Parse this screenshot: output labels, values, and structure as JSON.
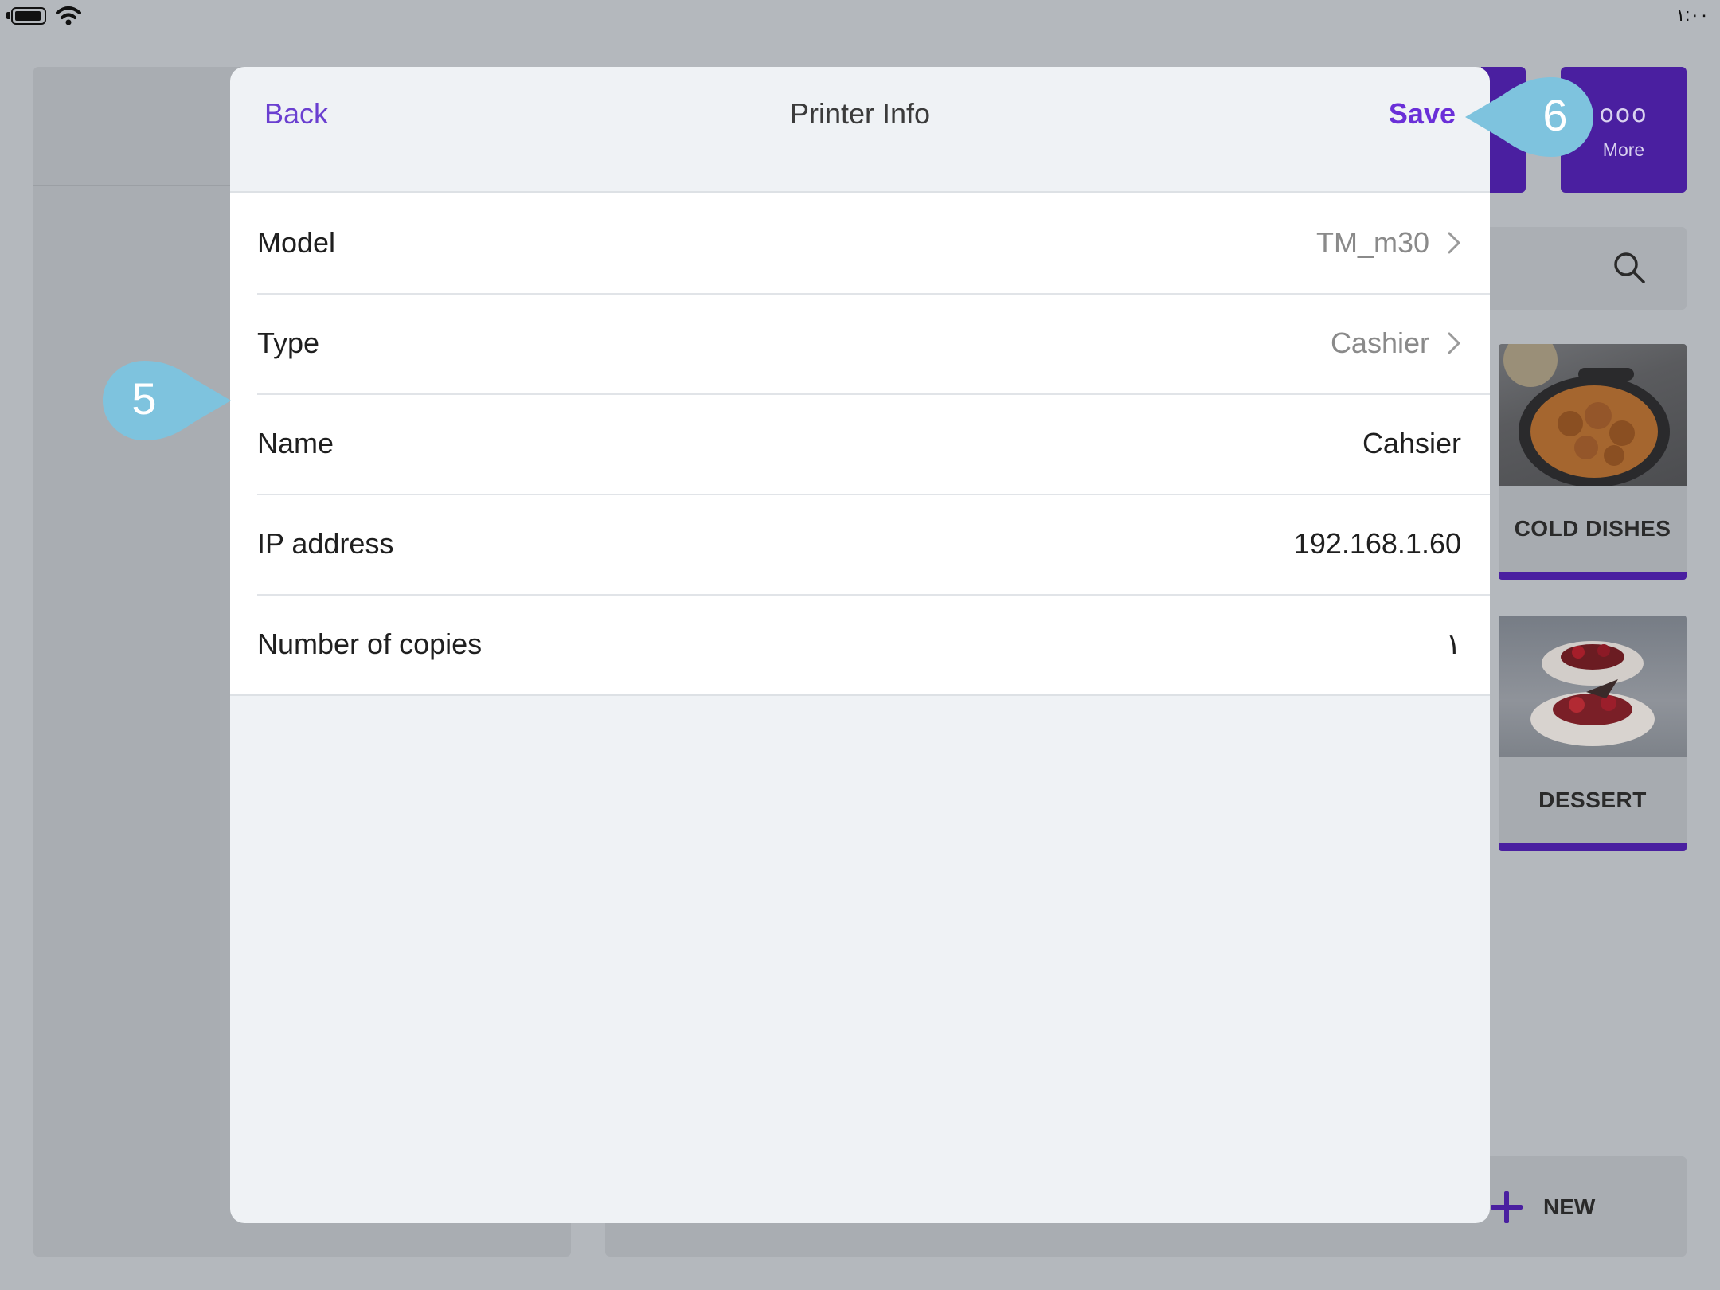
{
  "status_bar": {
    "time": "١:٠٠",
    "battery_icon": "battery-icon",
    "wifi_icon": "wifi-icon"
  },
  "background": {
    "more_button": {
      "icon": "more-dots-icon",
      "dots": "ooo",
      "label": "More"
    },
    "search_icon": "search-icon",
    "categories": [
      {
        "label": "COLD DISHES"
      },
      {
        "label": "DESSERT"
      }
    ],
    "new_button": {
      "icon": "plus-icon",
      "label": "NEW"
    }
  },
  "modal": {
    "title": "Printer Info",
    "back_label": "Back",
    "save_label": "Save",
    "rows": [
      {
        "label": "Model",
        "value": "TM_m30"
      },
      {
        "label": "Type",
        "value": "Cashier"
      },
      {
        "label": "Name",
        "value": "Cahsier"
      },
      {
        "label": "IP address",
        "value": "192.168.1.60"
      },
      {
        "label": "Number of copies",
        "value": "١"
      }
    ]
  },
  "callouts": [
    {
      "number": "5"
    },
    {
      "number": "6"
    }
  ],
  "colors": {
    "accent": "#6a3fd0",
    "brand_purple": "#4a1fa0",
    "callout": "#7ec3de",
    "modal_bg": "#eff2f5"
  }
}
